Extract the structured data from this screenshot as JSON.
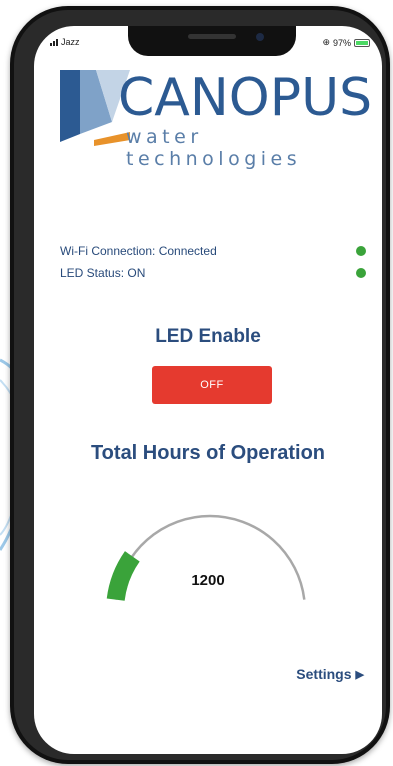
{
  "status_bar": {
    "carrier": "Jazz",
    "battery": "97%",
    "battery_level": 0.97
  },
  "logo": {
    "name": "CANOPUS",
    "tagline": "water technologies"
  },
  "device_status": [
    {
      "label": "Wi-Fi Connection: Connected",
      "indicator_color": "#3aa33a"
    },
    {
      "label": "LED Status: ON",
      "indicator_color": "#3aa33a"
    }
  ],
  "led_control": {
    "title": "LED Enable",
    "button_label": "OFF",
    "button_color": "#e53a2f"
  },
  "operation": {
    "title": "Total Hours of Operation",
    "value": "1200",
    "gauge_fraction": 0.17,
    "gauge_color": "#3aa33a",
    "track_color": "#a8a8a8"
  },
  "navigation": {
    "settings_label": "Settings",
    "settings_arrow": "▶"
  },
  "colors": {
    "brand_blue": "#2c5a92",
    "heading_blue": "#2b4d7e",
    "accent_orange": "#e8922a"
  }
}
